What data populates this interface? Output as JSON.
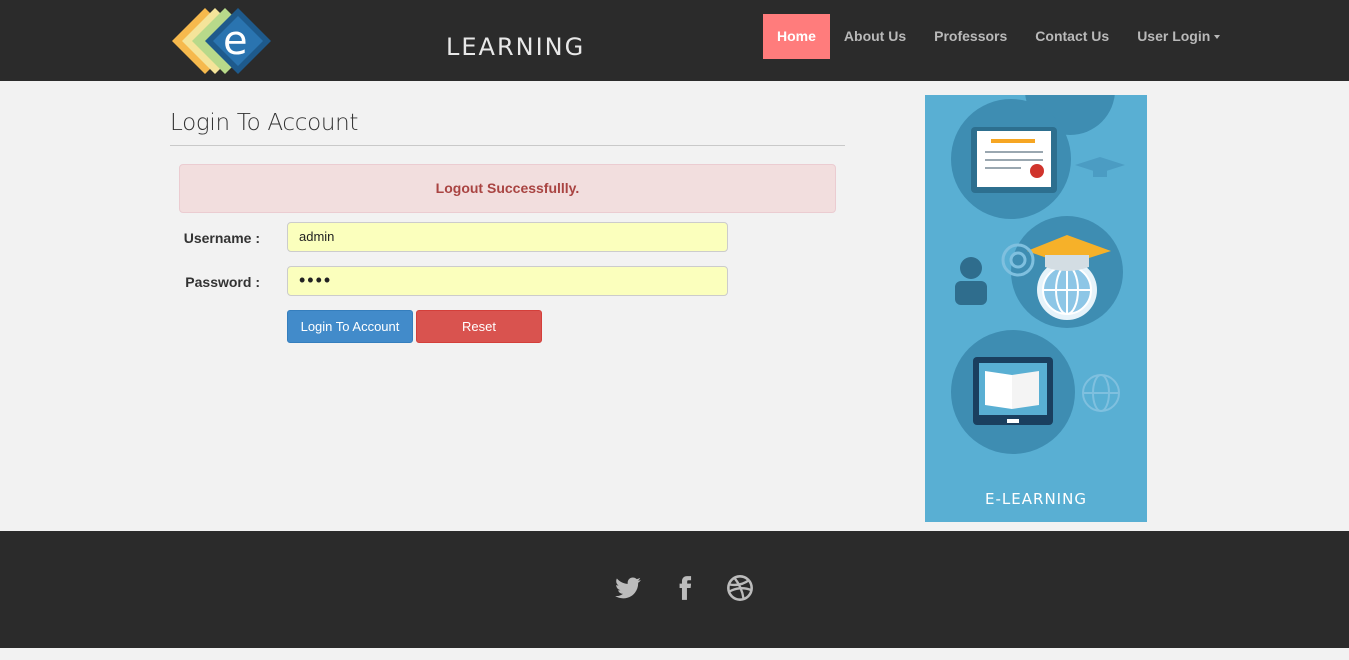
{
  "brand": {
    "logo_text": "LEARNING",
    "logo_letter": "e"
  },
  "nav": {
    "items": [
      {
        "label": "Home",
        "active": true
      },
      {
        "label": "About Us"
      },
      {
        "label": "Professors"
      },
      {
        "label": "Contact Us"
      },
      {
        "label": "User Login",
        "dropdown": true
      }
    ]
  },
  "login": {
    "title": "Login To Account",
    "alert": "Logout Successfullly.",
    "username_label": "Username :",
    "password_label": "Password :",
    "username_value": "admin",
    "password_value": "••••",
    "login_button": "Login To Account",
    "reset_button": "Reset"
  },
  "side_image": {
    "caption": "E-LEARNING"
  },
  "footer": {
    "icons": [
      "twitter-icon",
      "facebook-icon",
      "dribbble-icon"
    ]
  },
  "colors": {
    "header_bg": "#2b2b2b",
    "nav_active": "#ff7c7c",
    "alert_bg": "#f2dede",
    "alert_text": "#a94442",
    "input_bg": "#fbffbd",
    "login_btn": "#428bca",
    "reset_btn": "#d9534f",
    "side_bg": "#59afd3"
  }
}
